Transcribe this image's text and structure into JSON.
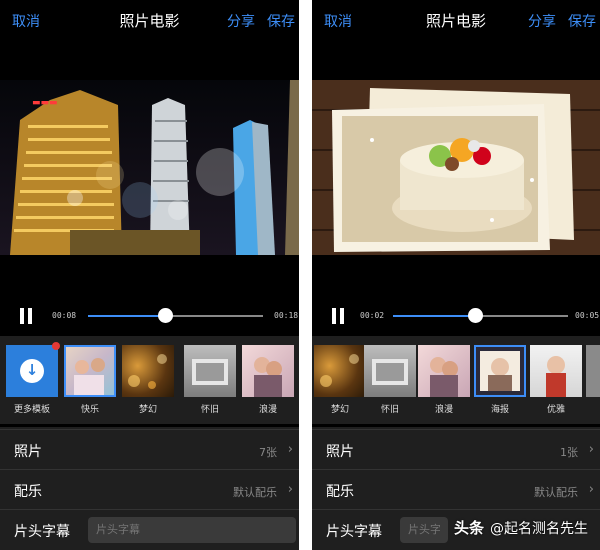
{
  "left": {
    "nav": {
      "cancel": "取消",
      "title": "照片电影",
      "share": "分享",
      "save": "保存"
    },
    "player": {
      "current_time": "00:08",
      "total_time": "00:18",
      "progress": 0.44
    },
    "templates": [
      {
        "label": "更多模板"
      },
      {
        "label": "快乐",
        "selected": true
      },
      {
        "label": "梦幻"
      },
      {
        "label": "怀旧"
      },
      {
        "label": "浪漫"
      }
    ],
    "settings": {
      "photos": {
        "label": "照片",
        "value": "7张"
      },
      "music": {
        "label": "配乐",
        "value": "默认配乐"
      },
      "title": {
        "label": "片头字幕",
        "placeholder": "片头字幕"
      }
    }
  },
  "right": {
    "nav": {
      "cancel": "取消",
      "title": "照片电影",
      "share": "分享",
      "save": "保存"
    },
    "player": {
      "current_time": "00:02",
      "total_time": "00:05",
      "progress": 0.47
    },
    "templates": [
      {
        "label": "梦幻"
      },
      {
        "label": "怀旧"
      },
      {
        "label": "浪漫"
      },
      {
        "label": "海报",
        "selected": true
      },
      {
        "label": "优雅"
      }
    ],
    "settings": {
      "photos": {
        "label": "照片",
        "value": "1张"
      },
      "music": {
        "label": "配乐",
        "value": "默认配乐"
      },
      "title": {
        "label": "片头字幕",
        "placeholder": "片头字幕"
      }
    }
  },
  "watermark": {
    "logo": "头条",
    "text": "@起名测名先生"
  },
  "colors": {
    "accent": "#3d8ef7",
    "background": "#000000",
    "panel": "#1f1f1f",
    "badge": "#e53935"
  }
}
